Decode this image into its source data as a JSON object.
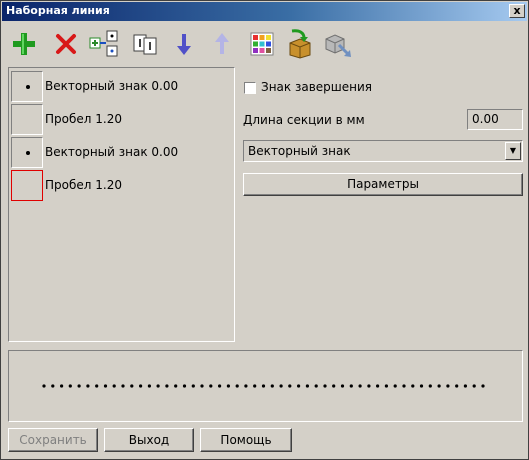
{
  "window": {
    "title": "Наборная линия",
    "close_label": "x"
  },
  "toolbar": {
    "buttons": [
      {
        "icon": "plus-icon",
        "enabled": true
      },
      {
        "icon": "delete-icon",
        "enabled": true
      },
      {
        "icon": "insert-element-icon",
        "enabled": true
      },
      {
        "icon": "space-icon",
        "enabled": true
      },
      {
        "icon": "move-down-icon",
        "enabled": true
      },
      {
        "icon": "move-up-icon",
        "enabled": false
      },
      {
        "icon": "color-palette-icon",
        "enabled": true
      },
      {
        "icon": "box-export-icon",
        "enabled": true
      },
      {
        "icon": "box-import-icon",
        "enabled": false
      }
    ]
  },
  "list": {
    "items": [
      {
        "label": "Векторный знак 0.00",
        "has_dot": true,
        "selected": false
      },
      {
        "label": "Пробел 1.20",
        "has_dot": false,
        "selected": false
      },
      {
        "label": "Векторный знак 0.00",
        "has_dot": true,
        "selected": false
      },
      {
        "label": "Пробел 1.20",
        "has_dot": false,
        "selected": true
      }
    ]
  },
  "properties": {
    "terminate_label": "Знак завершения",
    "terminate_checked": false,
    "section_length_label": "Длина секции в мм",
    "section_length_value": "0.00",
    "type_value": "Векторный знак",
    "params_button": "Параметры"
  },
  "preview": {
    "dot_count": 51
  },
  "footer": {
    "save_label": "Сохранить",
    "exit_label": "Выход",
    "help_label": "Помощь"
  }
}
